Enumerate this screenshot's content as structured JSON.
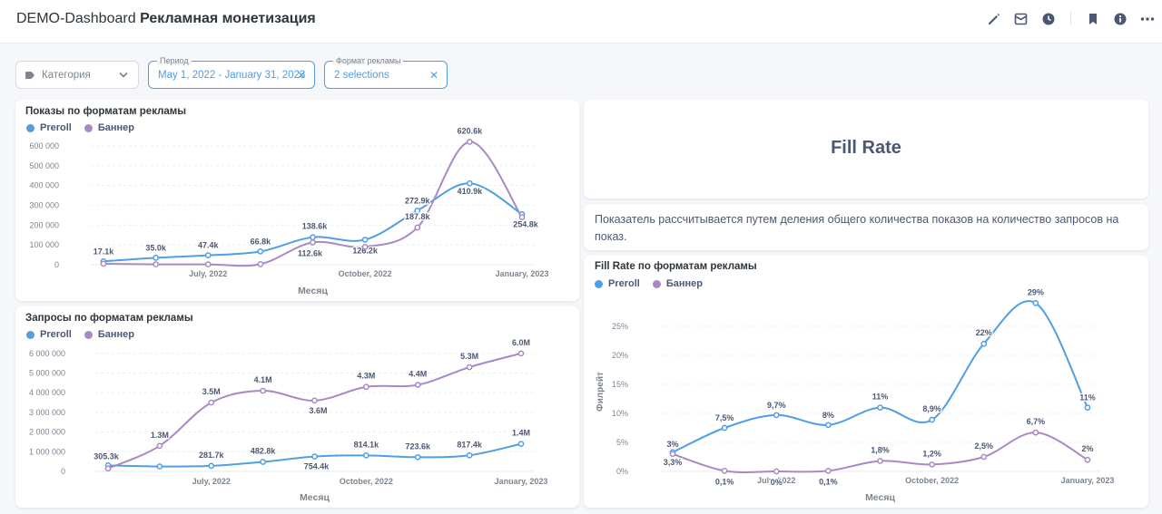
{
  "header": {
    "title_prefix": "DEMO-Dashboard",
    "title_main": "Рекламная монетизация"
  },
  "filters": {
    "category": {
      "label": "Категория"
    },
    "period": {
      "label": "Период",
      "value": "May 1, 2022 - January 31, 2023"
    },
    "format": {
      "label": "Формат рекламы",
      "value": "2 selections"
    }
  },
  "colors": {
    "preroll": "#509ee3",
    "banner": "#a989c5"
  },
  "cards": {
    "impressions": {
      "title": "Показы по форматам рекламы"
    },
    "requests": {
      "title": "Запросы по форматам рекламы"
    },
    "fillrate_heading": {
      "text": "Fill Rate"
    },
    "fillrate_desc": {
      "text": "Показатель рассчитывается путем деления общего количества показов на количество запросов на показ."
    },
    "fillrate": {
      "title": "Fill Rate по форматам рекламы"
    }
  },
  "chart_data": [
    {
      "type": "line",
      "title": "Показы по форматам рекламы",
      "xlabel": "Месяц",
      "ylabel": "",
      "ylim": [
        0,
        650000
      ],
      "yticks": [
        0,
        100000,
        200000,
        300000,
        400000,
        500000,
        600000
      ],
      "ytick_labels": [
        "0",
        "100 000",
        "200 000",
        "300 000",
        "400 000",
        "500 000",
        "600 000"
      ],
      "x": [
        "2022-05",
        "2022-06",
        "2022-07",
        "2022-08",
        "2022-09",
        "2022-10",
        "2022-11",
        "2022-12",
        "2023-01"
      ],
      "xtick_labels": {
        "2": "July, 2022",
        "5": "October, 2022",
        "8": "January, 2023"
      },
      "legend": "top-left",
      "grid": true,
      "series": [
        {
          "name": "Preroll",
          "color": "#509ee3",
          "values": [
            17100,
            35000,
            47400,
            66800,
            138600,
            126200,
            272900,
            410900,
            254800
          ],
          "labels": [
            "17.1k",
            "35.0k",
            "47.4k",
            "66.8k",
            "138.6k",
            "126.2k",
            "272.9k",
            "410.9k",
            "254.8k"
          ]
        },
        {
          "name": "Баннер",
          "color": "#a989c5",
          "values": [
            5000,
            2000,
            2000,
            3000,
            112600,
            90000,
            187800,
            620600,
            240000
          ],
          "labels": [
            "",
            "",
            "",
            "",
            "112.6k",
            "",
            "187.8k",
            "620.6k",
            ""
          ]
        }
      ]
    },
    {
      "type": "line",
      "title": "Запросы по форматам рекламы",
      "xlabel": "Месяц",
      "ylabel": "",
      "ylim": [
        0,
        6500000
      ],
      "yticks": [
        0,
        1000000,
        2000000,
        3000000,
        4000000,
        5000000,
        6000000
      ],
      "ytick_labels": [
        "0",
        "1 000 000",
        "2 000 000",
        "3 000 000",
        "4 000 000",
        "5 000 000",
        "6 000 000"
      ],
      "x": [
        "2022-05",
        "2022-06",
        "2022-07",
        "2022-08",
        "2022-09",
        "2022-10",
        "2022-11",
        "2022-12",
        "2023-01"
      ],
      "xtick_labels": {
        "2": "July, 2022",
        "5": "October, 2022",
        "8": "January, 2023"
      },
      "legend": "top-left",
      "grid": true,
      "series": [
        {
          "name": "Preroll",
          "color": "#509ee3",
          "values": [
            305300,
            250000,
            281700,
            482800,
            754400,
            814100,
            723600,
            817400,
            1400000
          ],
          "labels": [
            "305.3k",
            "",
            "281.7k",
            "482.8k",
            "754.4k",
            "814.1k",
            "723.6k",
            "817.4k",
            "1.4M"
          ]
        },
        {
          "name": "Баннер",
          "color": "#a989c5",
          "values": [
            150000,
            1300000,
            3500000,
            4100000,
            3600000,
            4300000,
            4400000,
            5300000,
            6000000
          ],
          "labels": [
            "",
            "1.3M",
            "3.5M",
            "4.1M",
            "3.6M",
            "4.3M",
            "4.4M",
            "5.3M",
            "6.0M"
          ]
        }
      ]
    },
    {
      "type": "line",
      "title": "Fill Rate по форматам рекламы",
      "xlabel": "Месяц",
      "ylabel": "Филрейт",
      "ylim": [
        0,
        30
      ],
      "yticks": [
        0,
        5,
        10,
        15,
        20,
        25
      ],
      "ytick_labels": [
        "0%",
        "5%",
        "10%",
        "15%",
        "20%",
        "25%"
      ],
      "x": [
        "2022-05",
        "2022-06",
        "2022-07",
        "2022-08",
        "2022-09",
        "2022-10",
        "2022-11",
        "2022-12",
        "2023-01"
      ],
      "xtick_labels": {
        "2": "July, 2022",
        "5": "October, 2022",
        "8": "January, 2023"
      },
      "legend": "top-left",
      "grid": true,
      "series": [
        {
          "name": "Preroll",
          "color": "#509ee3",
          "values": [
            3.3,
            7.5,
            9.7,
            8,
            11,
            8.9,
            22,
            29,
            11
          ],
          "labels": [
            "3,3%",
            "7,5%",
            "9,7%",
            "8%",
            "11%",
            "8,9%",
            "22%",
            "29%",
            "11%"
          ]
        },
        {
          "name": "Баннер",
          "color": "#a989c5",
          "values": [
            3,
            0.1,
            0,
            0.1,
            1.8,
            1.2,
            2.5,
            6.7,
            2
          ],
          "labels": [
            "3%",
            "0,1%",
            "0%",
            "0,1%",
            "1,8%",
            "1,2%",
            "2,5%",
            "6,7%",
            "2%"
          ]
        }
      ]
    }
  ]
}
